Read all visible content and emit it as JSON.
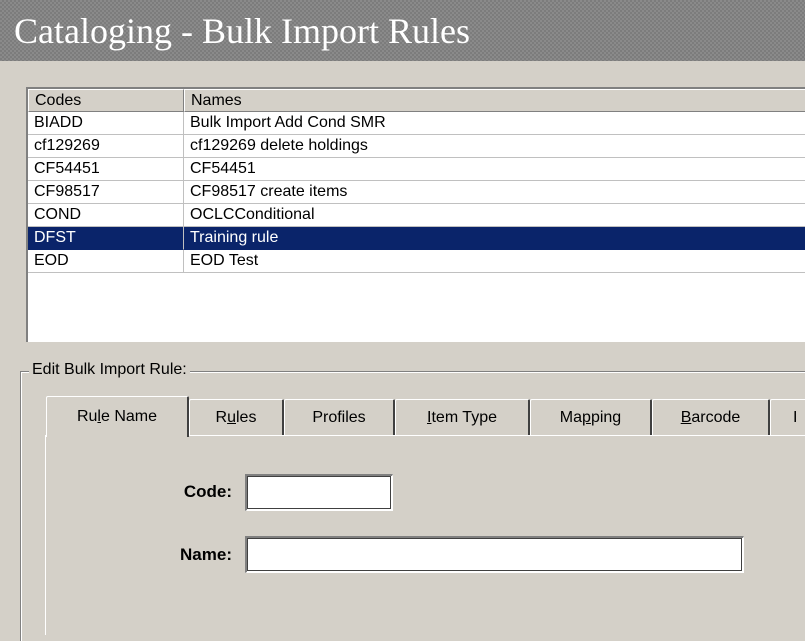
{
  "window": {
    "title": "Cataloging - Bulk Import Rules"
  },
  "list": {
    "columns": [
      "Codes",
      "Names"
    ],
    "rows": [
      {
        "code": "BIADD",
        "name": "Bulk Import Add Cond  SMR"
      },
      {
        "code": "cf129269",
        "name": "cf129269 delete holdings"
      },
      {
        "code": "CF54451",
        "name": "CF54451"
      },
      {
        "code": "CF98517",
        "name": "CF98517 create items"
      },
      {
        "code": "COND",
        "name": "OCLCConditional"
      },
      {
        "code": "DFST",
        "name": "Training rule"
      },
      {
        "code": "EOD",
        "name": "EOD Test"
      }
    ],
    "selected_code": "DFST",
    "selection_color": "#0a246a"
  },
  "edit": {
    "group_label": "Edit  Bulk Import Rule:",
    "tabs": [
      {
        "pre": "Ru",
        "mn": "l",
        "post": "e Name",
        "active": true
      },
      {
        "pre": "R",
        "mn": "u",
        "post": "les",
        "active": false
      },
      {
        "pre": "Profiles",
        "mn": "",
        "post": "",
        "active": false
      },
      {
        "pre": "",
        "mn": "I",
        "post": "tem Type",
        "active": false
      },
      {
        "pre": "Ma",
        "mn": "p",
        "post": "ping",
        "active": false
      },
      {
        "pre": "",
        "mn": "B",
        "post": "arcode",
        "active": false
      },
      {
        "pre": "I",
        "mn": "",
        "post": "",
        "active": false
      }
    ],
    "code_label": "Code:",
    "code_value": "",
    "name_label": "Name:",
    "name_value": ""
  }
}
